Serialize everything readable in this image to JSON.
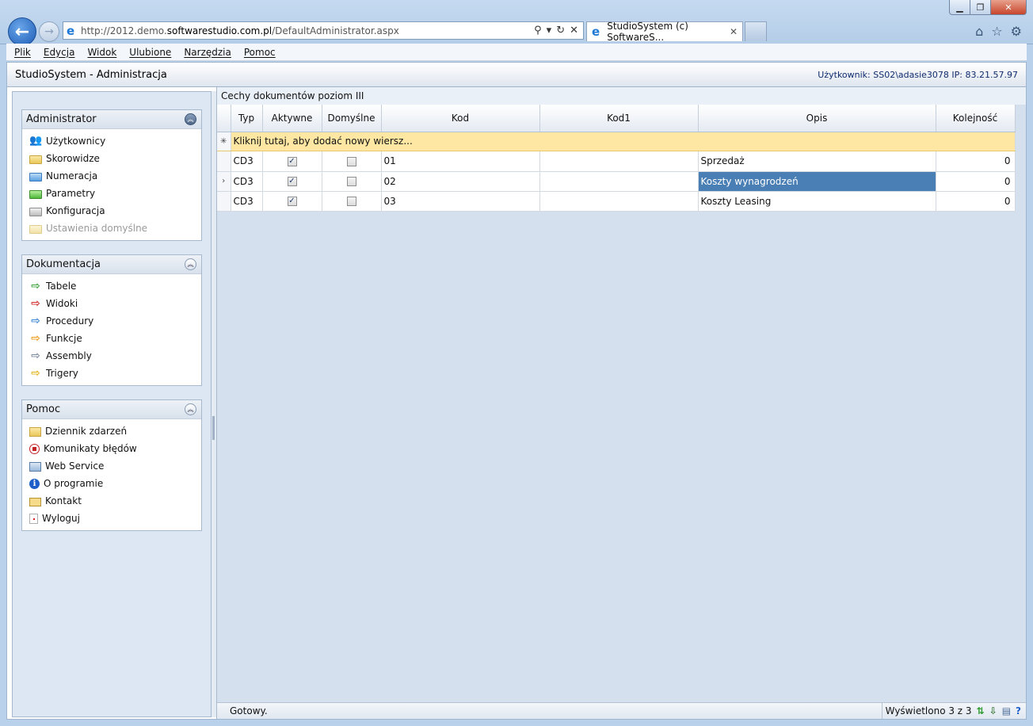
{
  "browser": {
    "url_prefix": "http://2012.demo.",
    "url_domain": "softwarestudio.com.pl",
    "url_suffix": "/DefaultAdministrator.aspx",
    "tab_title": "StudioSystem (c) SoftwareS...",
    "menu": [
      "Plik",
      "Edycja",
      "Widok",
      "Ulubione",
      "Narzędzia",
      "Pomoc"
    ]
  },
  "app": {
    "title": "StudioSystem - Administracja",
    "user_info": "Użytkownik: SS02\\adasie3078 IP: 83.21.57.97"
  },
  "sidebar": {
    "groups": [
      {
        "title": "Administrator",
        "items": [
          {
            "label": "Użytkownicy",
            "icon": "users-icon"
          },
          {
            "label": "Skorowidze",
            "icon": "folder-icon"
          },
          {
            "label": "Numeracja",
            "icon": "folder-icon"
          },
          {
            "label": "Parametry",
            "icon": "folder-icon"
          },
          {
            "label": "Konfiguracja",
            "icon": "folder-icon"
          },
          {
            "label": "Ustawienia domyślne",
            "icon": "folder-icon",
            "disabled": true
          }
        ]
      },
      {
        "title": "Dokumentacja",
        "items": [
          {
            "label": "Tabele",
            "icon": "arrow-right-icon"
          },
          {
            "label": "Widoki",
            "icon": "arrow-right-icon"
          },
          {
            "label": "Procedury",
            "icon": "arrow-right-icon"
          },
          {
            "label": "Funkcje",
            "icon": "arrow-right-icon"
          },
          {
            "label": "Assembly",
            "icon": "arrow-right-icon"
          },
          {
            "label": "Trigery",
            "icon": "arrow-right-icon"
          }
        ]
      },
      {
        "title": "Pomoc",
        "items": [
          {
            "label": "Dziennik zdarzeń",
            "icon": "journal-icon"
          },
          {
            "label": "Komunikaty błędów",
            "icon": "error-icon"
          },
          {
            "label": "Web Service",
            "icon": "web-service-icon"
          },
          {
            "label": "O programie",
            "icon": "info-icon"
          },
          {
            "label": "Kontakt",
            "icon": "mail-icon"
          },
          {
            "label": "Wyloguj",
            "icon": "logout-icon"
          }
        ]
      }
    ]
  },
  "grid": {
    "title": "Cechy dokumentów poziom III",
    "columns": [
      "Typ",
      "Aktywne",
      "Domyślne",
      "Kod",
      "Kod1",
      "Opis",
      "Kolejność"
    ],
    "add_row_text": "Kliknij tutaj, aby dodać nowy wiersz...",
    "rows": [
      {
        "typ": "CD3",
        "aktywne": true,
        "domyslne": false,
        "kod": "01",
        "kod1": "",
        "opis": "Sprzedaż",
        "kolejnosc": "0"
      },
      {
        "typ": "CD3",
        "aktywne": true,
        "domyslne": false,
        "kod": "02",
        "kod1": "",
        "opis": "Koszty wynagrodzeń",
        "kolejnosc": "0"
      },
      {
        "typ": "CD3",
        "aktywne": true,
        "domyslne": false,
        "kod": "03",
        "kod1": "",
        "opis": "Koszty Leasing",
        "kolejnosc": "0"
      }
    ],
    "selected_row": 1
  },
  "status": {
    "left": "Gotowy.",
    "right": "Wyświetlono 3 z 3"
  }
}
